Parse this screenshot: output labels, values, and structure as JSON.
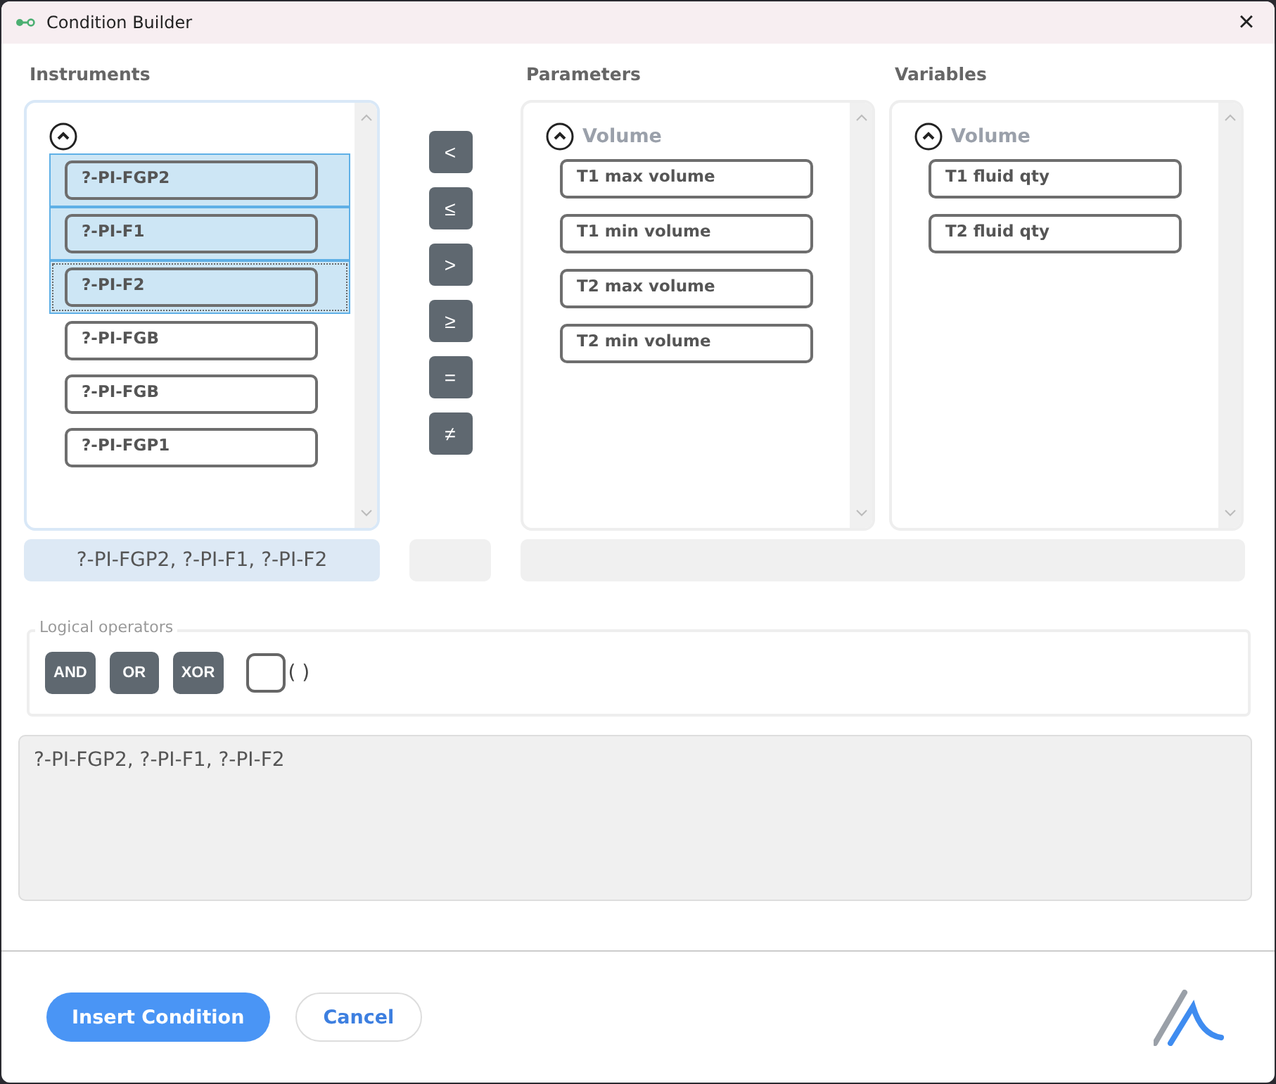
{
  "window": {
    "title": "Condition Builder",
    "close": "×"
  },
  "instruments": {
    "heading": "Instruments",
    "items": [
      {
        "label": "?-PI-FGP2",
        "selected": true
      },
      {
        "label": "?-PI-F1",
        "selected": true
      },
      {
        "label": "?-PI-F2",
        "selected": true
      },
      {
        "label": "?-PI-FGB",
        "selected": false
      },
      {
        "label": "?-PI-FGB",
        "selected": false
      },
      {
        "label": "?-PI-FGP1",
        "selected": false
      }
    ],
    "summary": "?-PI-FGP2, ?-PI-F1, ?-PI-F2"
  },
  "operators": [
    "<",
    "≤",
    ">",
    "≥",
    "=",
    "≠"
  ],
  "parameters": {
    "heading": "Parameters",
    "group": "Volume",
    "items": [
      "T1 max volume",
      "T1 min volume",
      "T2 max volume",
      "T2 min volume"
    ]
  },
  "variables": {
    "heading": "Variables",
    "group": "Volume",
    "items": [
      "T1 fluid qty",
      "T2 fluid qty"
    ]
  },
  "logical_operators": {
    "legend": "Logical operators",
    "buttons": [
      "AND",
      "OR",
      "XOR"
    ],
    "parentheses": {
      "label": "( )",
      "checked": false
    }
  },
  "expression": "?-PI-FGP2, ?-PI-F1, ?-PI-F2",
  "buttons": {
    "primary": "Insert Condition",
    "secondary": "Cancel"
  }
}
